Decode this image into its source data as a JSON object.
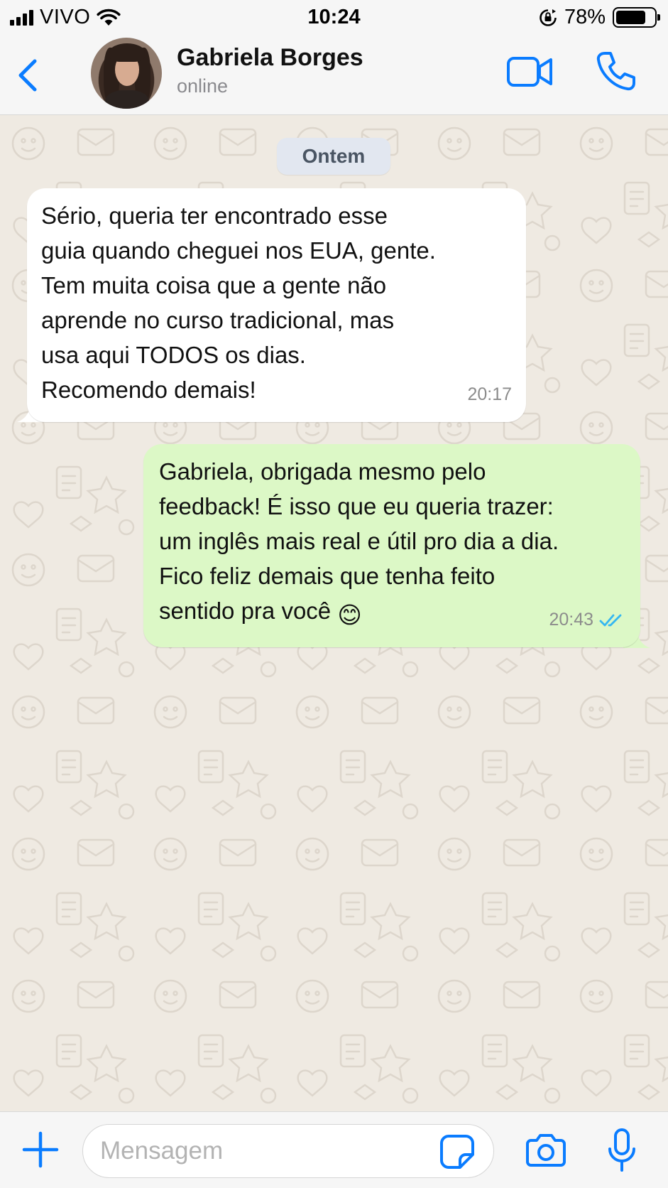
{
  "status_bar": {
    "carrier": "VIVO",
    "time": "10:24",
    "battery_percent": "78%",
    "battery_level": 0.78,
    "icons": [
      "signal-icon",
      "wifi-icon",
      "rotation-lock-icon",
      "battery-icon"
    ]
  },
  "header": {
    "contact_name": "Gabriela Borges",
    "contact_status": "online",
    "icons": [
      "chevron-left-icon",
      "video-camera-icon",
      "phone-icon"
    ]
  },
  "chat": {
    "date_label": "Ontem",
    "messages": [
      {
        "direction": "incoming",
        "text": "Sério, queria ter encontrado esse\nguia quando cheguei nos EUA, gente.\nTem muita coisa que a gente não\naprende no curso tradicional, mas\nusa aqui TODOS os dias.\nRecomendo demais!",
        "time": "20:17"
      },
      {
        "direction": "outgoing",
        "text": "Gabriela, obrigada mesmo pelo\nfeedback! É isso que eu queria trazer:\num inglês mais real e útil pro dia a dia.\nFico feliz demais que tenha feito\nsentido pra você ",
        "emoji": "😊",
        "time": "20:43",
        "status": "read"
      }
    ]
  },
  "input_bar": {
    "placeholder": "Mensagem",
    "value": "",
    "icons": [
      "plus-icon",
      "sticker-icon",
      "camera-icon",
      "microphone-icon"
    ]
  },
  "colors": {
    "accent": "#0a7cff",
    "incoming_bubble": "#ffffff",
    "outgoing_bubble": "#dcf8c6",
    "chat_background": "#efeae2",
    "read_ticks": "#34b7f1"
  }
}
